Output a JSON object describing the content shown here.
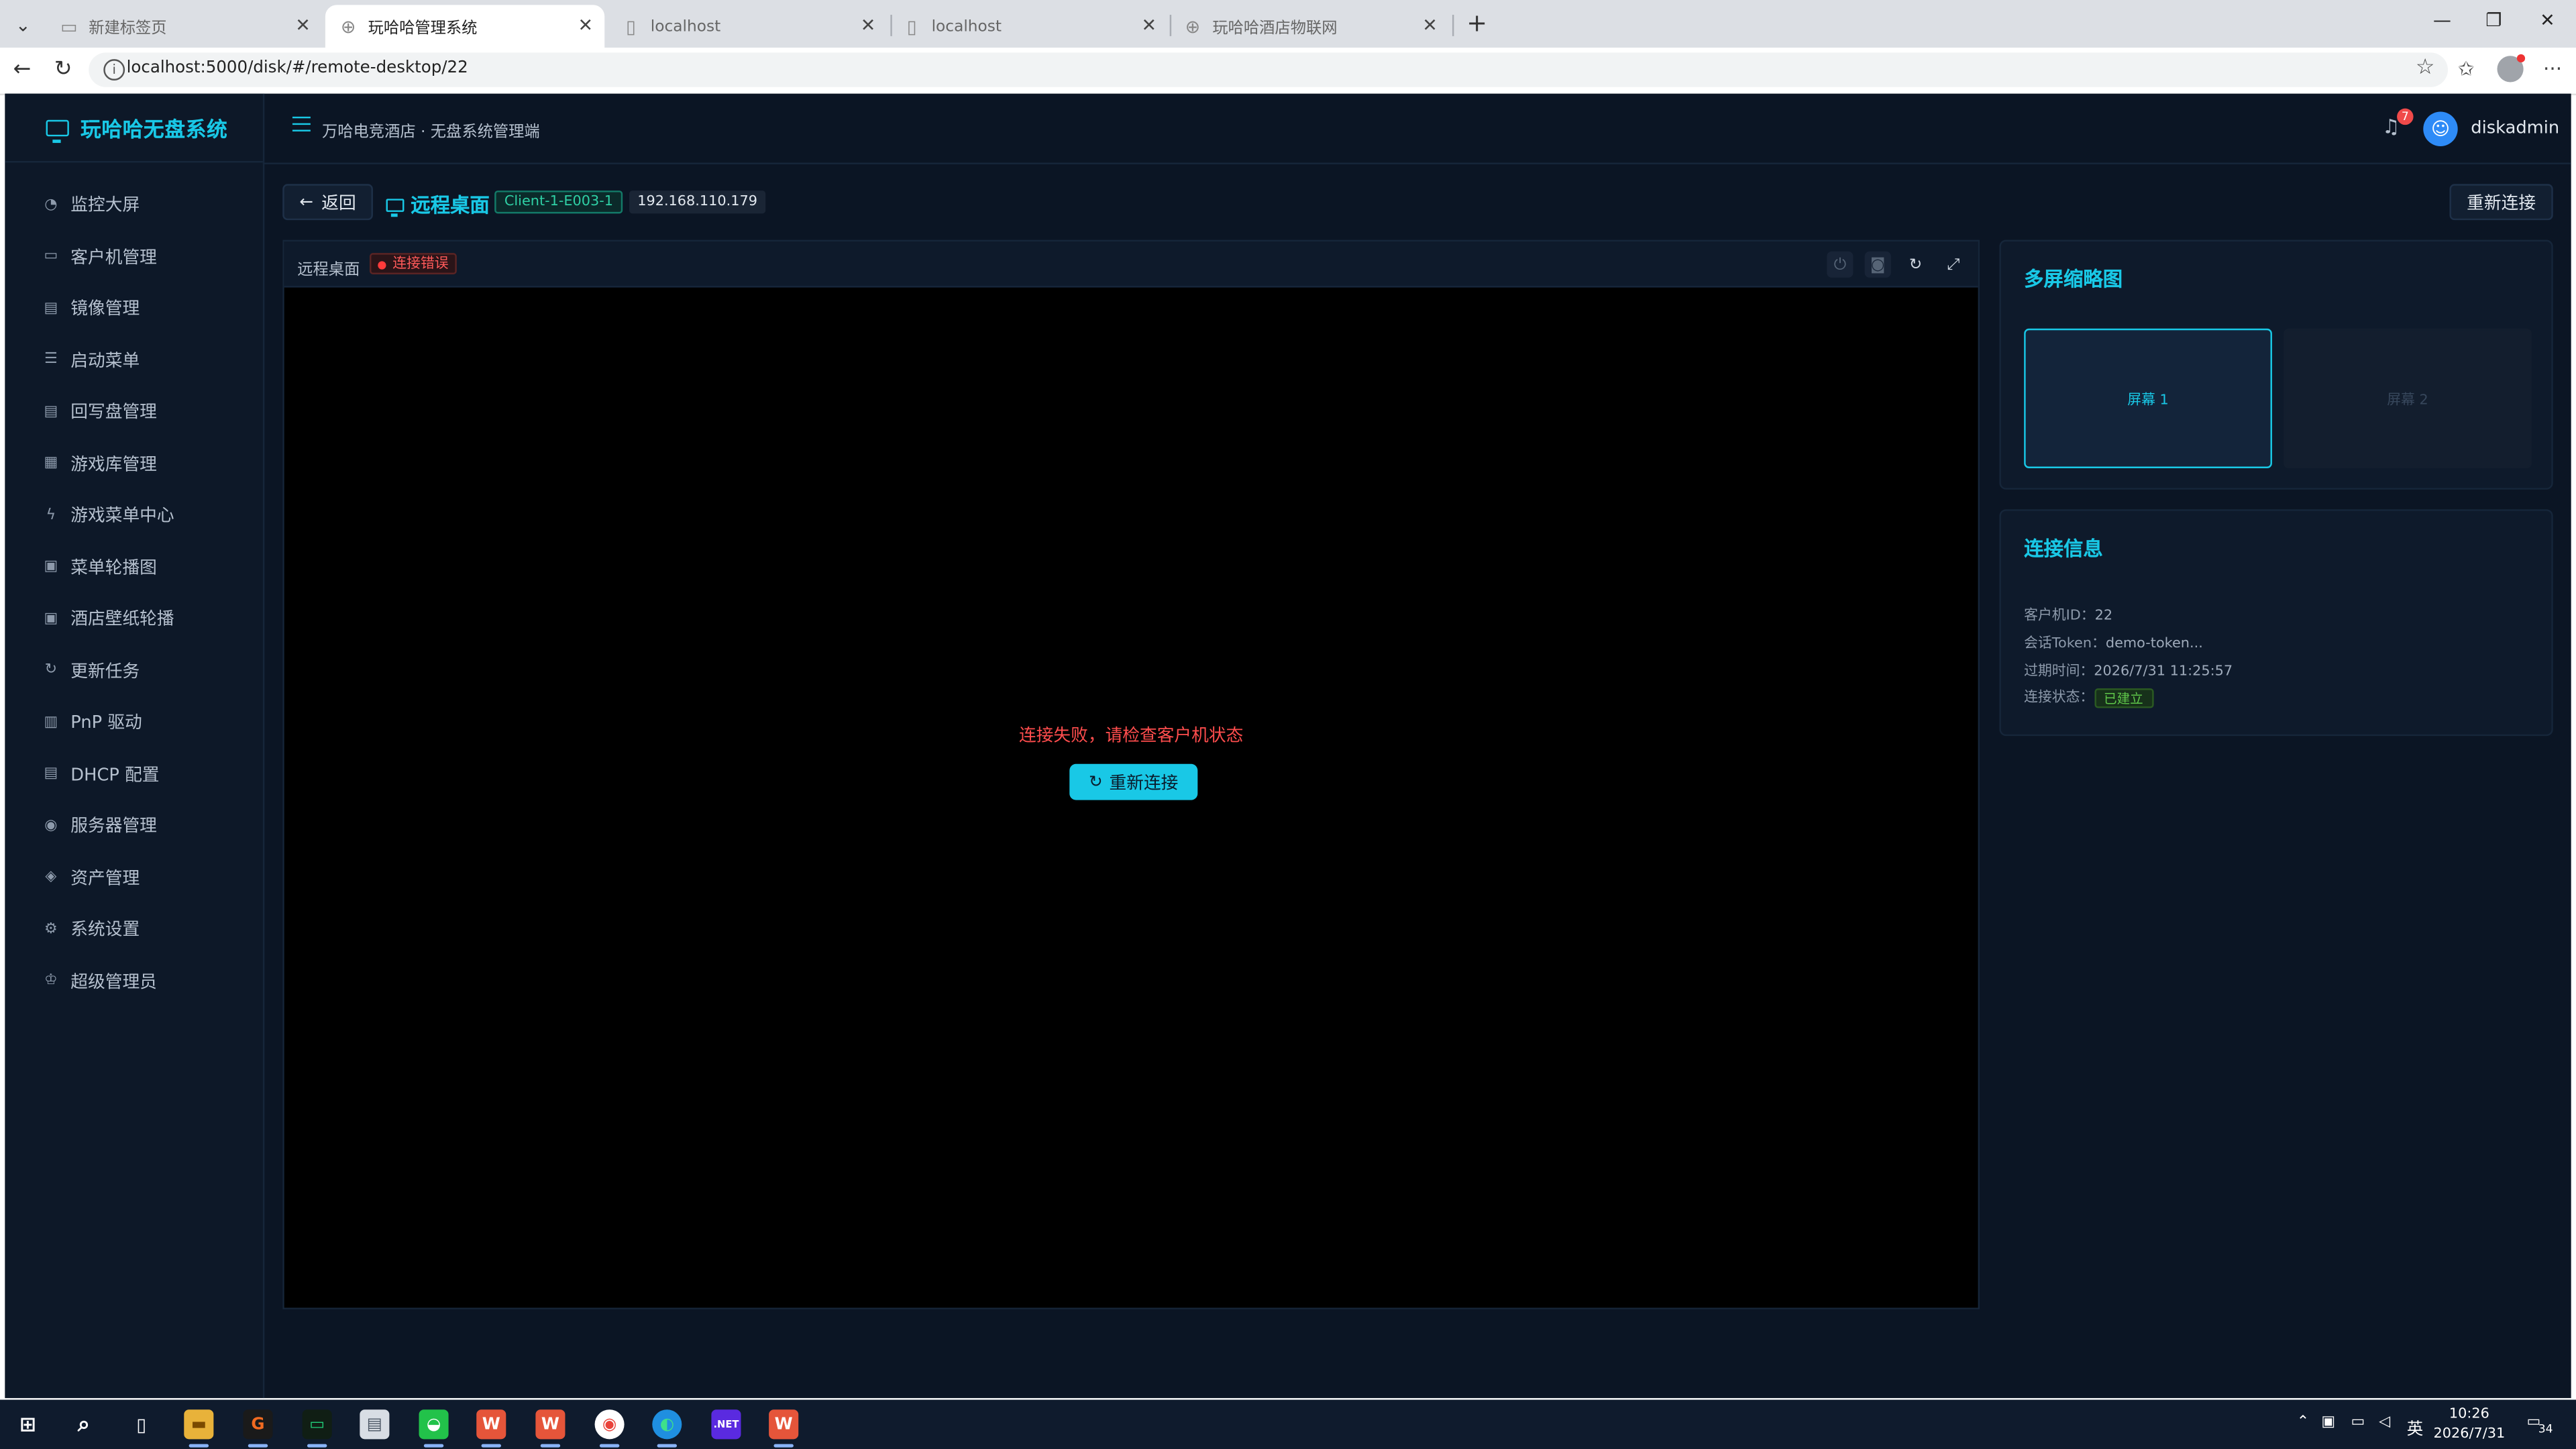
{
  "browser": {
    "tabs": [
      {
        "title": "新建标签页",
        "active": false
      },
      {
        "title": "玩哈哈管理系统",
        "active": true
      },
      {
        "title": "localhost",
        "active": false
      },
      {
        "title": "localhost",
        "active": false
      },
      {
        "title": "玩哈哈酒店物联网",
        "active": false
      }
    ],
    "url": "localhost:5000/disk/#/remote-desktop/22"
  },
  "sidebar": {
    "logo": "玩哈哈无盘系统",
    "items": [
      {
        "label": "监控大屏",
        "icon": "dashboard-icon"
      },
      {
        "label": "客户机管理",
        "icon": "monitor-icon"
      },
      {
        "label": "镜像管理",
        "icon": "document-icon"
      },
      {
        "label": "启动菜单",
        "icon": "list-icon"
      },
      {
        "label": "回写盘管理",
        "icon": "document-icon"
      },
      {
        "label": "游戏库管理",
        "icon": "grid-icon"
      },
      {
        "label": "游戏菜单中心",
        "icon": "lightning-icon"
      },
      {
        "label": "菜单轮播图",
        "icon": "picture-icon"
      },
      {
        "label": "酒店壁纸轮播",
        "icon": "picture-icon"
      },
      {
        "label": "更新任务",
        "icon": "refresh-icon"
      },
      {
        "label": "PnP 驱动",
        "icon": "chip-icon"
      },
      {
        "label": "DHCP 配置",
        "icon": "document-icon"
      },
      {
        "label": "服务器管理",
        "icon": "eye-icon"
      },
      {
        "label": "资产管理",
        "icon": "shield-icon"
      },
      {
        "label": "系统设置",
        "icon": "gear-icon"
      },
      {
        "label": "超级管理员",
        "icon": "crown-icon"
      }
    ]
  },
  "topbar": {
    "breadcrumb": "万哈电竞酒店 · 无盘系统管理端",
    "notification_count": "7",
    "username": "diskadmin"
  },
  "header": {
    "back_label": "返回",
    "title": "远程桌面",
    "client_name": "Client-1-E003-1",
    "ip": "192.168.110.179",
    "reconnect_label": "重新连接"
  },
  "remote": {
    "panel_title": "远程桌面",
    "status_label": "连接错误",
    "error_message": "连接失败，请检查客户机状态",
    "reconnect_label": "重新连接"
  },
  "thumbnails": {
    "title": "多屏缩略图",
    "screens": [
      {
        "label": "屏幕 1",
        "active": true
      },
      {
        "label": "屏幕 2",
        "active": false
      }
    ]
  },
  "connection": {
    "title": "连接信息",
    "client_id_label": "客户机ID：",
    "client_id": "22",
    "token_label": "会话Token：",
    "token": "demo-token...",
    "expire_label": "过期时间：",
    "expire": "2026/7/31 11:25:57",
    "status_label": "连接状态：",
    "status": "已建立"
  },
  "taskbar": {
    "ime": "英",
    "time": "10:26",
    "date": "2026/7/31",
    "notification_count": "34"
  },
  "colors": {
    "accent": "#19c8e6",
    "background": "#0b1524",
    "error": "#ff4d4d",
    "success": "#5fc74a"
  }
}
